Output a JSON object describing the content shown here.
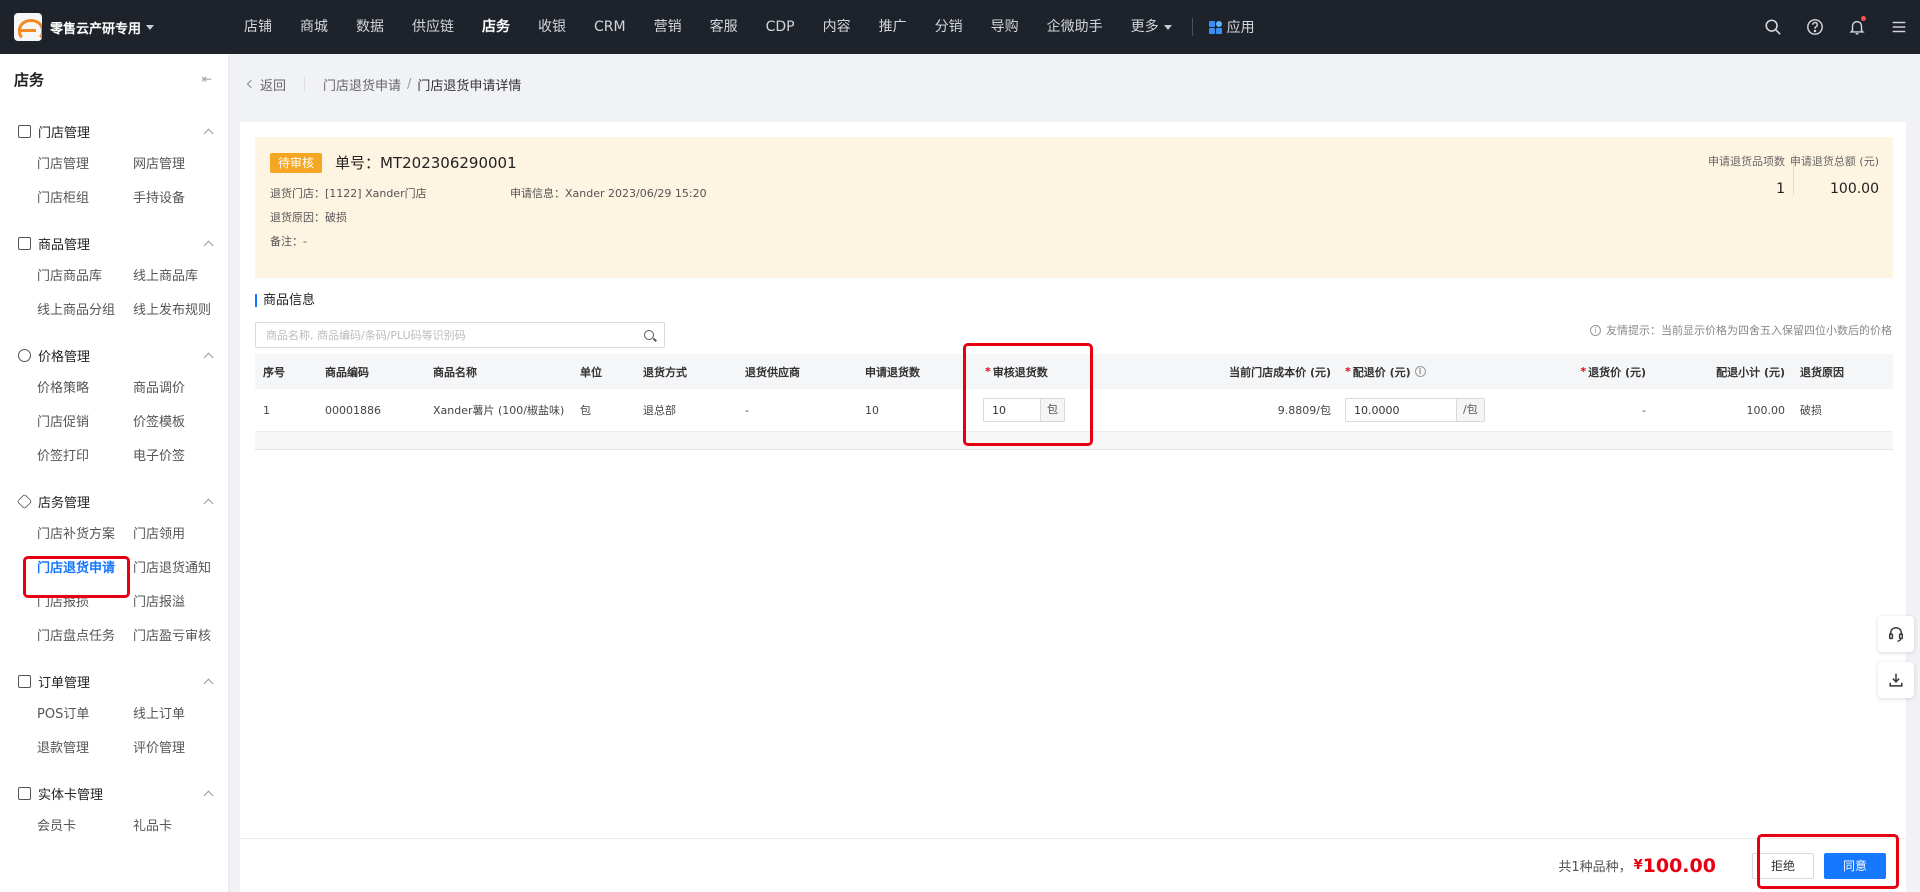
{
  "app": {
    "brand": "零售云产研专用",
    "nav": [
      "店铺",
      "商城",
      "数据",
      "供应链",
      "店务",
      "收银",
      "CRM",
      "营销",
      "客服",
      "CDP",
      "内容",
      "推广",
      "分销",
      "导购",
      "企微助手",
      "更多"
    ],
    "active_nav": "店务",
    "apps_label": "应用",
    "icons": [
      "search-icon",
      "help-icon",
      "bell-icon",
      "menu-icon"
    ]
  },
  "sidebar": {
    "title": "店务",
    "groups": [
      {
        "title": "门店管理",
        "items": [
          "门店管理",
          "网店管理",
          "门店柜组",
          "手持设备"
        ]
      },
      {
        "title": "商品管理",
        "items": [
          "门店商品库",
          "线上商品库",
          "线上商品分组",
          "线上发布规则"
        ]
      },
      {
        "title": "价格管理",
        "items": [
          "价格策略",
          "商品调价",
          "门店促销",
          "价签模板",
          "价签打印",
          "电子价签"
        ]
      },
      {
        "title": "店务管理",
        "items": [
          "门店补货方案",
          "门店领用",
          "门店退货申请",
          "门店退货通知",
          "门店报损",
          "门店报溢",
          "门店盘点任务",
          "门店盈亏审核"
        ]
      },
      {
        "title": "订单管理",
        "items": [
          "POS订单",
          "线上订单",
          "退款管理",
          "评价管理"
        ]
      },
      {
        "title": "实体卡管理",
        "items": [
          "会员卡",
          "礼品卡"
        ]
      }
    ],
    "active_item": "门店退货申请"
  },
  "breadcrumb": {
    "back": "返回",
    "parent": "门店退货申请",
    "current": "门店退货申请详情"
  },
  "order": {
    "status": "待审核",
    "number": "单号：MT202306290001",
    "store": "退货门店：[1122] Xander门店",
    "apply_info": "申请信息：Xander 2023/06/29 15:20",
    "reason": "退货原因：破损",
    "remark": "备注：-",
    "item_count_label": "申请退货品项数",
    "item_count": "1",
    "total_label": "申请退货总额 (元)",
    "total": "100.00"
  },
  "products": {
    "title": "商品信息",
    "search_placeholder": "商品名称, 商品编码/条码/PLU码等识别码",
    "tip": "友情提示：当前显示价格为四舍五入保留四位小数后的价格",
    "columns": {
      "index": "序号",
      "code": "商品编码",
      "name": "商品名称",
      "unit": "单位",
      "method": "退货方式",
      "supplier": "退货供应商",
      "apply_qty": "申请退货数",
      "audit_qty": "审核退货数",
      "cost": "当前门店成本价 (元)",
      "dist_price": "配退价 (元)",
      "return_price": "退货价 (元)",
      "subtotal": "配退小计 (元)",
      "reason": "退货原因"
    },
    "rows": [
      {
        "index": "1",
        "code": "00001886",
        "name": "Xander薯片 (100/椒盐味)",
        "unit": "包",
        "method": "退总部",
        "supplier": "-",
        "apply_qty": "10",
        "audit_qty": "10",
        "audit_unit": "包",
        "cost": "9.8809/包",
        "dist_price": "10.0000",
        "dist_unit": "/包",
        "return_price": "-",
        "subtotal": "100.00",
        "reason": "破损"
      }
    ]
  },
  "footer": {
    "summary": "共1种品种，",
    "currency": "¥",
    "amount": "100.00",
    "reject": "拒绝",
    "approve": "同意"
  },
  "colors": {
    "accent": "#1677ff",
    "status": "#f5a623",
    "highlight": "#e60012"
  }
}
